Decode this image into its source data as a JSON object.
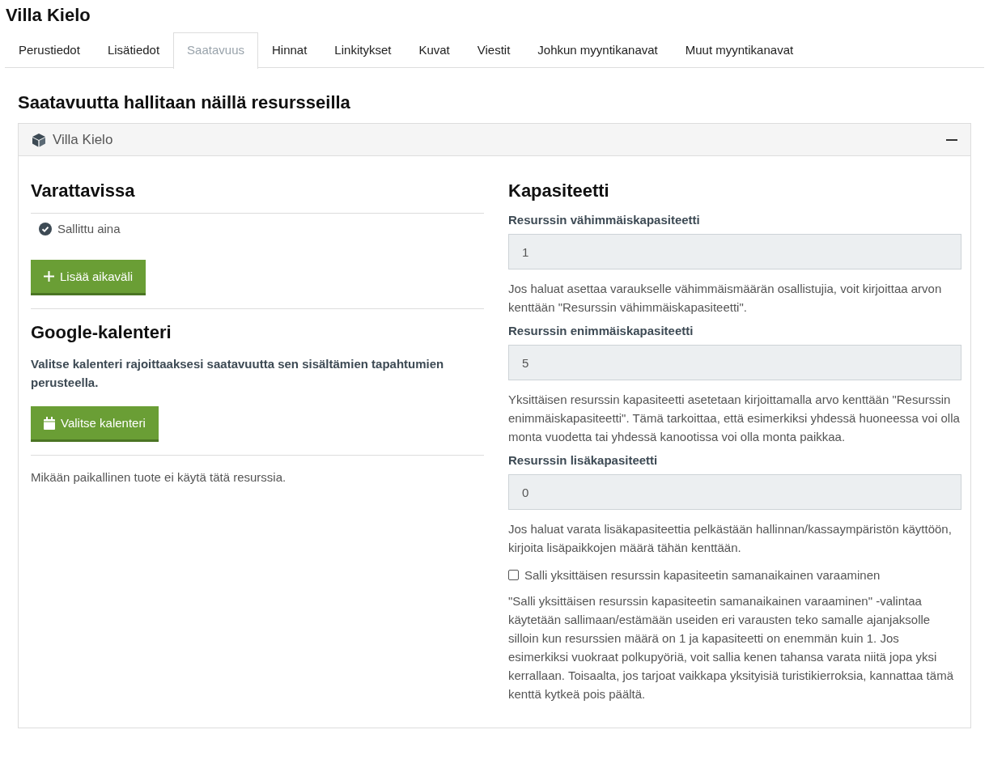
{
  "page_title": "Villa Kielo",
  "tabs": [
    {
      "label": "Perustiedot",
      "selected": false
    },
    {
      "label": "Lisätiedot",
      "selected": false
    },
    {
      "label": "Saatavuus",
      "selected": true
    },
    {
      "label": "Hinnat",
      "selected": false
    },
    {
      "label": "Linkitykset",
      "selected": false
    },
    {
      "label": "Kuvat",
      "selected": false
    },
    {
      "label": "Viestit",
      "selected": false
    },
    {
      "label": "Johkun myyntikanavat",
      "selected": false
    },
    {
      "label": "Muut myyntikanavat",
      "selected": false
    }
  ],
  "heading": "Saatavuutta hallitaan näillä resursseilla",
  "panel": {
    "title": "Villa Kielo",
    "availability": {
      "heading": "Varattavissa",
      "items": [
        "Sallittu aina"
      ],
      "add_button": "Lisää aikaväli"
    },
    "google_calendar": {
      "heading": "Google-kalenteri",
      "description": "Valitse kalenteri rajoittaaksesi saatavuutta sen sisältämien tapahtumien perusteella.",
      "button": "Valitse kalenteri"
    },
    "usage_note": "Mikään paikallinen tuote ei käytä tätä resurssia.",
    "capacity": {
      "heading": "Kapasiteetti",
      "fields": [
        {
          "label": "Resurssin vähimmäiskapasiteetti",
          "value": "1",
          "help": "Jos haluat asettaa varaukselle vähimmäismäärän osallistujia, voit kirjoittaa arvon kenttään \"Resurssin vähimmäiskapasiteetti\"."
        },
        {
          "label": "Resurssin enimmäiskapasiteetti",
          "value": "5",
          "help": "Yksittäisen resurssin kapasiteetti asetetaan kirjoittamalla arvo kenttään \"Resurssin enimmäiskapasiteetti\". Tämä tarkoittaa, että esimerkiksi yhdessä huoneessa voi olla monta vuodetta tai yhdessä kanootissa voi olla monta paikkaa."
        },
        {
          "label": "Resurssin lisäkapasiteetti",
          "value": "0",
          "help": "Jos haluat varata lisäkapasiteettia pelkästään hallinnan/kassaympäristön käyttöön, kirjoita lisäpaikkojen määrä tähän kenttään."
        }
      ],
      "checkbox": {
        "label": "Salli yksittäisen resurssin kapasiteetin samanaikainen varaaminen",
        "checked": false,
        "help": "\"Salli yksittäisen resurssin kapasiteetin samanaikainen varaaminen\" -valintaa käytetään sallimaan/estämään useiden eri varausten teko samalle ajanjaksolle silloin kun resurssien määrä on 1 ja kapasiteetti on enemmän kuin 1. Jos esimerkiksi vuokraat polkupyöriä, voit sallia kenen tahansa varata niitä jopa yksi kerrallaan. Toisaalta, jos tarjoat vaikkapa yksityisiä turistikierroksia, kannattaa tämä kenttä kytkeä pois päältä."
      }
    }
  }
}
